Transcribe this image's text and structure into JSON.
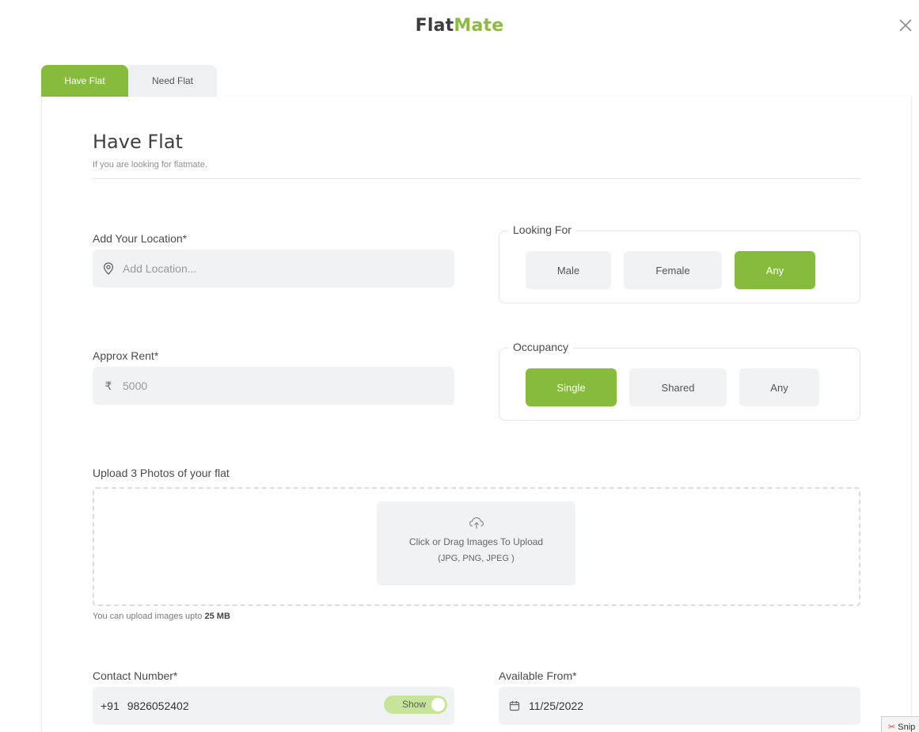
{
  "app": {
    "logo_part1": "Flat",
    "logo_part2": "Mate"
  },
  "tabs": [
    {
      "label": "Have Flat",
      "active": true
    },
    {
      "label": "Need Flat",
      "active": false
    }
  ],
  "form": {
    "title": "Have Flat",
    "subtitle": "If you are looking for flatmate.",
    "location": {
      "label": "Add Your Location*",
      "placeholder": "Add Location...",
      "icon": "map-pin-icon"
    },
    "rent": {
      "label": "Approx Rent*",
      "placeholder": "5000",
      "icon": "rupee-icon",
      "currency_symbol": "₹"
    },
    "looking_for": {
      "legend": "Looking For",
      "options": [
        "Male",
        "Female",
        "Any"
      ],
      "selected": "Any"
    },
    "occupancy": {
      "legend": "Occupancy",
      "options": [
        "Single",
        "Shared",
        "Any"
      ],
      "selected": "Single"
    },
    "upload": {
      "label": "Upload 3 Photos of your flat",
      "instruction": "Click or Drag Images To Upload",
      "formats": "(JPG, PNG, JPEG )",
      "limit_prefix": "You can upload images upto",
      "limit_value": "25 MB",
      "icon": "cloud-upload-icon"
    },
    "contact": {
      "label": "Contact Number*",
      "country_code": "+91",
      "value": "9826052402",
      "toggle_label": "Show",
      "toggle_on": true
    },
    "available": {
      "label": "Available From*",
      "value": "11/25/2022",
      "icon": "calendar-icon"
    }
  },
  "overlay": {
    "snip_text": "Snip"
  },
  "colors": {
    "accent": "#86bb3e",
    "logo_dark": "#3d3d3d",
    "logo_green": "#8dbb3c",
    "input_bg": "#f1f2f4"
  }
}
